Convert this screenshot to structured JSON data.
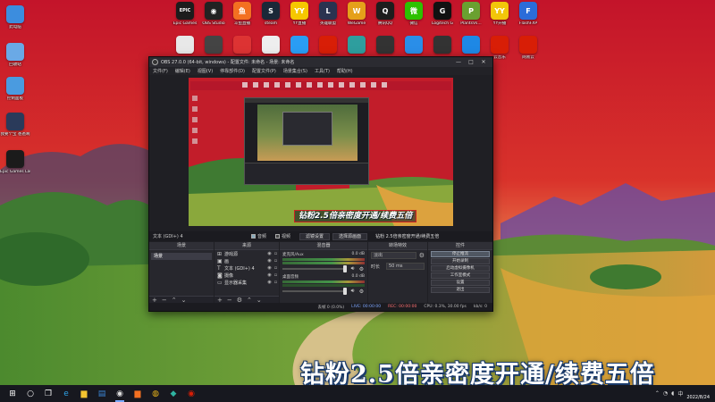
{
  "desktop": {
    "left_icons": [
      {
        "label": "此电脑",
        "icon": "computer-icon",
        "color": "#3c8dde"
      },
      {
        "label": "回收站",
        "icon": "recycle-bin-icon",
        "color": "#6aa9e6"
      },
      {
        "label": "控制面板",
        "icon": "control-panel-icon",
        "color": "#4a9be0"
      },
      {
        "label": "我要个宝 爸爸啊",
        "icon": "app-icon",
        "color": "#2a3a5a"
      },
      {
        "label": "Epic Games Launcher",
        "icon": "epic-games-icon",
        "color": "#1b1b1b"
      }
    ],
    "top_icons": [
      {
        "label": "Epic Games",
        "glyph": "EPIC",
        "icon": "epic-games-icon",
        "color": "#1c1c1c"
      },
      {
        "label": "OBS Studio",
        "glyph": "◉",
        "icon": "obs-icon",
        "color": "#222"
      },
      {
        "label": "斗鱼直播",
        "glyph": "鱼",
        "icon": "douyu-icon",
        "color": "#f37021"
      },
      {
        "label": "steam",
        "glyph": "S",
        "icon": "steam-icon",
        "color": "#1b2838"
      },
      {
        "label": "YY直播",
        "glyph": "YY",
        "icon": "yy-icon",
        "color": "#f6c700"
      },
      {
        "label": "英雄联盟",
        "glyph": "L",
        "icon": "lol-icon",
        "color": "#2a3350"
      },
      {
        "label": "WeGame",
        "glyph": "W",
        "icon": "wegame-icon",
        "color": "#e5a01a"
      },
      {
        "label": "腾讯QQ",
        "glyph": "Q",
        "icon": "qq-icon",
        "color": "#1d1d1d"
      },
      {
        "label": "微信",
        "glyph": "微",
        "icon": "wechat-icon",
        "color": "#2dc100"
      },
      {
        "label": "Logitech G",
        "glyph": "G",
        "icon": "logitech-icon",
        "color": "#111"
      },
      {
        "label": "PlantsVs...",
        "glyph": "P",
        "icon": "game-icon",
        "color": "#6aa030"
      },
      {
        "label": "YY开播",
        "glyph": "YY",
        "icon": "yy-icon",
        "color": "#f2c60a"
      },
      {
        "label": "FlashFXP",
        "glyph": "F",
        "icon": "flash-icon",
        "color": "#2b6cd9"
      }
    ],
    "top_icons_row2": [
      {
        "label": "",
        "color": "#e8e8e8"
      },
      {
        "label": "",
        "color": "#444"
      },
      {
        "label": "",
        "color": "#d33"
      },
      {
        "label": "",
        "color": "#eee"
      },
      {
        "label": "",
        "color": "#2a9df4"
      },
      {
        "label": "",
        "color": "#d81e06"
      },
      {
        "label": "",
        "color": "#2e9e9e"
      },
      {
        "label": "",
        "color": "#333"
      },
      {
        "label": "",
        "color": "#2a8ee8"
      },
      {
        "label": "",
        "color": "#333"
      },
      {
        "label": "",
        "color": "#1e88e5"
      },
      {
        "label": "云音乐",
        "color": "#d81e06"
      },
      {
        "label": "网易云",
        "color": "#d81e06"
      }
    ]
  },
  "obs": {
    "title": "OBS 27.0.0 (64-bit, windows) - 配置文件: 未命名 - 场景: 未命名",
    "menu": [
      "文件(F)",
      "编辑(E)",
      "视图(V)",
      "停靠部件(D)",
      "配置文件(P)",
      "场景集合(S)",
      "工具(T)",
      "帮助(H)"
    ],
    "window_buttons": [
      "—",
      "□",
      "✕"
    ],
    "preview_title": "钻粉2.5倍亲密度开通/续费五倍",
    "status_line": {
      "scene_label": "文本 (GDI+) 4",
      "checkboxes": [
        {
          "label": "音频",
          "on": true
        },
        {
          "label": "视频",
          "on": false
        }
      ],
      "buttons": [
        "滤镜设置",
        "选择源画面"
      ],
      "watermark_text": "钻粉 2.5倍亲密度开通/续费五倍"
    },
    "docks": {
      "scenes": {
        "title": "场景",
        "items": [
          "场景"
        ]
      },
      "sources": {
        "title": "来源",
        "items": [
          {
            "icon": "game-capture-icon",
            "glyph": "⊞",
            "name": "游戏源"
          },
          {
            "icon": "image-icon",
            "glyph": "▣",
            "name": "画"
          },
          {
            "icon": "text-icon",
            "glyph": "T",
            "name": "文本 (GDI+) 4"
          },
          {
            "icon": "camera-icon",
            "glyph": "◙",
            "name": "摄像"
          },
          {
            "icon": "display-icon",
            "glyph": "▭",
            "name": "显示器采集"
          }
        ]
      },
      "mixer": {
        "title": "混音器",
        "channels": [
          {
            "name": "麦克风/Aux",
            "db": "0.0 dB",
            "active": true
          },
          {
            "name": "桌面音频",
            "db": "0.0 dB",
            "active": false
          }
        ]
      },
      "transitions": {
        "title": "转场特效",
        "type": "淡出",
        "duration_label": "时长",
        "duration_value": "50 ms"
      },
      "controls": {
        "title": "控件",
        "buttons": [
          "停止推流",
          "开始录制",
          "启动虚拟摄像机",
          "工作室模式",
          "设置",
          "退出"
        ]
      }
    },
    "bottom_status": {
      "dropped": "丢帧 0 (0.0%)",
      "live": "LIVE: 00:00:00",
      "rec": "REC: 00:00:00",
      "cpu": "CPU: 0.3%, 30.00 fps",
      "kbps": "kb/s: 0"
    }
  },
  "overlay_subtitle": "钻粉2.5倍亲密度开通/续费五倍",
  "taskbar": {
    "apps": [
      {
        "icon": "windows-start-icon",
        "glyph": "⊞",
        "color": "#fff"
      },
      {
        "icon": "search-icon",
        "glyph": "○",
        "color": "#fff"
      },
      {
        "icon": "task-view-icon",
        "glyph": "❐",
        "color": "#fff"
      },
      {
        "icon": "edge-icon",
        "glyph": "e",
        "color": "#2ea3e8"
      },
      {
        "icon": "file-explorer-icon",
        "glyph": "▆",
        "color": "#f4c430"
      },
      {
        "icon": "store-icon",
        "glyph": "▤",
        "color": "#3b86d6"
      },
      {
        "icon": "obs-icon",
        "glyph": "◉",
        "color": "#ddd",
        "active": true
      },
      {
        "icon": "douyu-icon",
        "glyph": "▆",
        "color": "#f37021"
      },
      {
        "icon": "chrome-icon",
        "glyph": "◍",
        "color": "#e8b41a"
      },
      {
        "icon": "wegame-icon",
        "glyph": "◆",
        "color": "#2fb3a1"
      },
      {
        "icon": "netease-music-icon",
        "glyph": "◉",
        "color": "#d81e06"
      }
    ],
    "tray_date": "2022/8/24"
  }
}
